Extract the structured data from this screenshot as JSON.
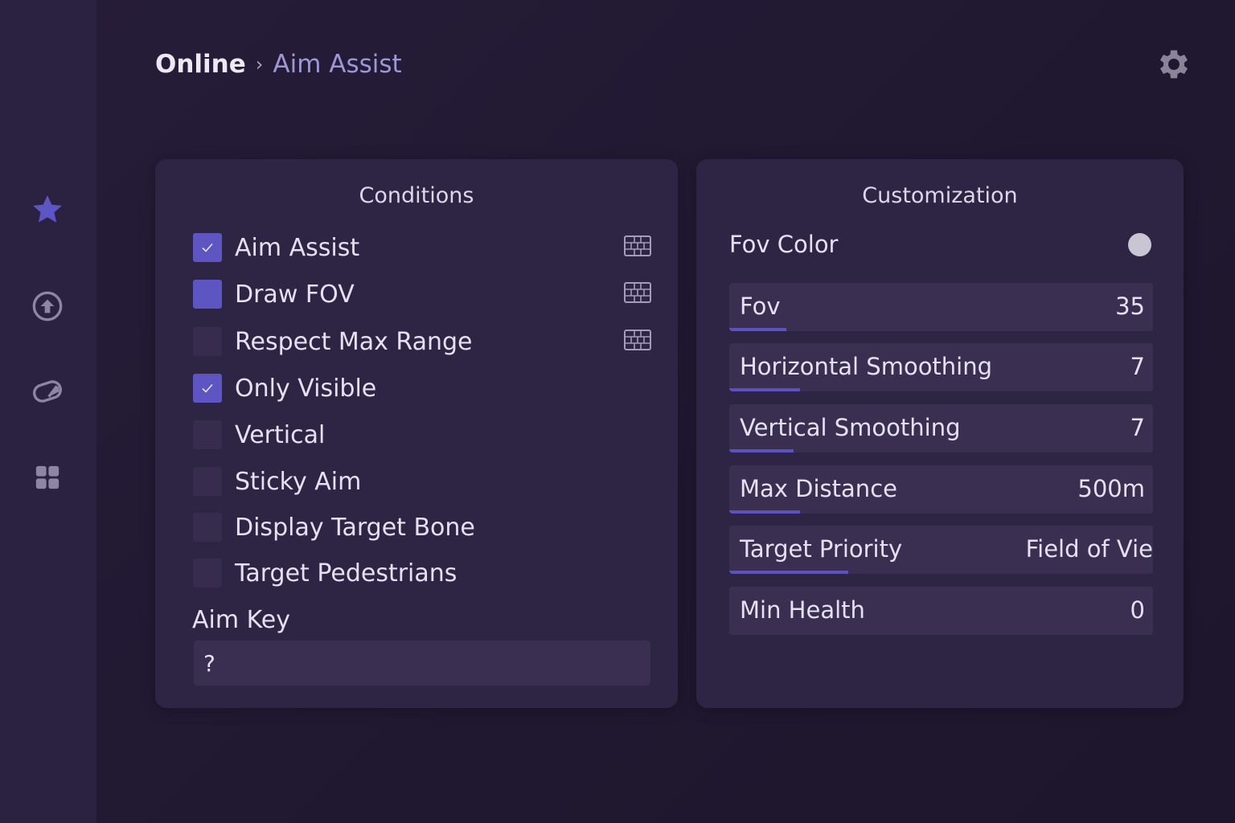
{
  "header": {
    "breadcrumb_root": "Online",
    "breadcrumb_separator": "›",
    "breadcrumb_current": "Aim Assist"
  },
  "sidebar": {
    "items": [
      {
        "icon": "star-icon",
        "active": true
      },
      {
        "icon": "upload-circle-icon",
        "active": false
      },
      {
        "icon": "eraser-icon",
        "active": false
      },
      {
        "icon": "grid-icon",
        "active": false
      }
    ]
  },
  "conditions": {
    "title": "Conditions",
    "items": [
      {
        "label": "Aim Assist",
        "state": "checked",
        "keybind": true
      },
      {
        "label": "Draw FOV",
        "state": "filled",
        "keybind": true
      },
      {
        "label": "Respect Max Range",
        "state": "unchecked",
        "keybind": true
      },
      {
        "label": "Only Visible",
        "state": "checked",
        "keybind": false
      },
      {
        "label": "Vertical",
        "state": "unchecked",
        "keybind": false
      },
      {
        "label": "Sticky Aim",
        "state": "unchecked",
        "keybind": false
      },
      {
        "label": "Display Target Bone",
        "state": "unchecked",
        "keybind": false
      },
      {
        "label": "Target Pedestrians",
        "state": "unchecked",
        "keybind": false
      }
    ],
    "aim_key_label": "Aim Key",
    "aim_key_value": "?"
  },
  "customization": {
    "title": "Customization",
    "fov_color_label": "Fov Color",
    "fov_color": "#c9c6d3",
    "sliders": [
      {
        "label": "Fov",
        "value": "35",
        "fill": 0.135
      },
      {
        "label": "Horizontal Smoothing",
        "value": "7",
        "fill": 0.167
      },
      {
        "label": "Vertical Smoothing",
        "value": "7",
        "fill": 0.152
      },
      {
        "label": "Max Distance",
        "value": "500m",
        "fill": 0.167
      },
      {
        "label": "Target Priority",
        "value": "Field of Vie",
        "fill": 0.28
      },
      {
        "label": "Min Health",
        "value": "0",
        "fill": 0
      }
    ]
  },
  "colors": {
    "accent": "#5d56c2",
    "background": "#221a33",
    "panel": "#2e2443"
  }
}
